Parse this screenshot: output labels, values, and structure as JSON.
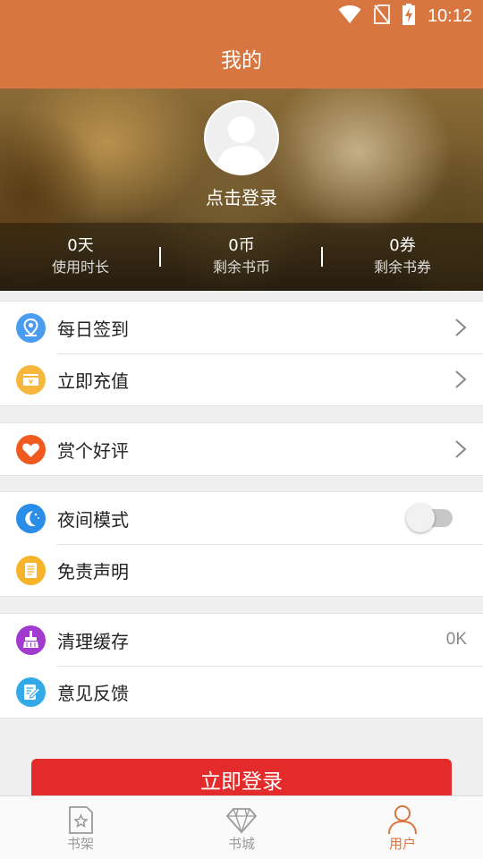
{
  "status_bar": {
    "time": "10:12",
    "icons": [
      "wifi-icon",
      "no-sim-icon",
      "battery-charging-icon"
    ]
  },
  "header": {
    "title": "我的"
  },
  "profile": {
    "avatar": "default-avatar-icon",
    "login_hint": "点击登录",
    "stats": [
      {
        "value": "0天",
        "label": "使用时长"
      },
      {
        "value": "0币",
        "label": "剩余书币"
      },
      {
        "value": "0券",
        "label": "剩余书券"
      }
    ]
  },
  "menu": {
    "daily_checkin": {
      "label": "每日签到",
      "icon": "location-pin-icon",
      "color": "#4a9cf0"
    },
    "recharge": {
      "label": "立即充值",
      "icon": "wallet-icon",
      "color": "#f6b73c"
    },
    "rate": {
      "label": "赏个好评",
      "icon": "heart-icon",
      "color": "#f05a1f"
    },
    "night_mode": {
      "label": "夜间模式",
      "icon": "moon-icon",
      "color": "#2a8de8",
      "enabled": false
    },
    "disclaimer": {
      "label": "免责声明",
      "icon": "document-icon",
      "color": "#f6b42a"
    },
    "clear_cache": {
      "label": "清理缓存",
      "icon": "broom-icon",
      "color": "#a33ad0",
      "value": "0K"
    },
    "feedback": {
      "label": "意见反馈",
      "icon": "edit-note-icon",
      "color": "#33a9e8"
    }
  },
  "login_button": {
    "label": "立即登录"
  },
  "tabbar": {
    "tabs": [
      {
        "label": "书架",
        "icon": "bookshelf-icon",
        "active": false
      },
      {
        "label": "书城",
        "icon": "diamond-icon",
        "active": false
      },
      {
        "label": "用户",
        "icon": "user-icon",
        "active": true
      }
    ]
  },
  "colors": {
    "accent": "#d87642",
    "login_button": "#e32b2b"
  }
}
